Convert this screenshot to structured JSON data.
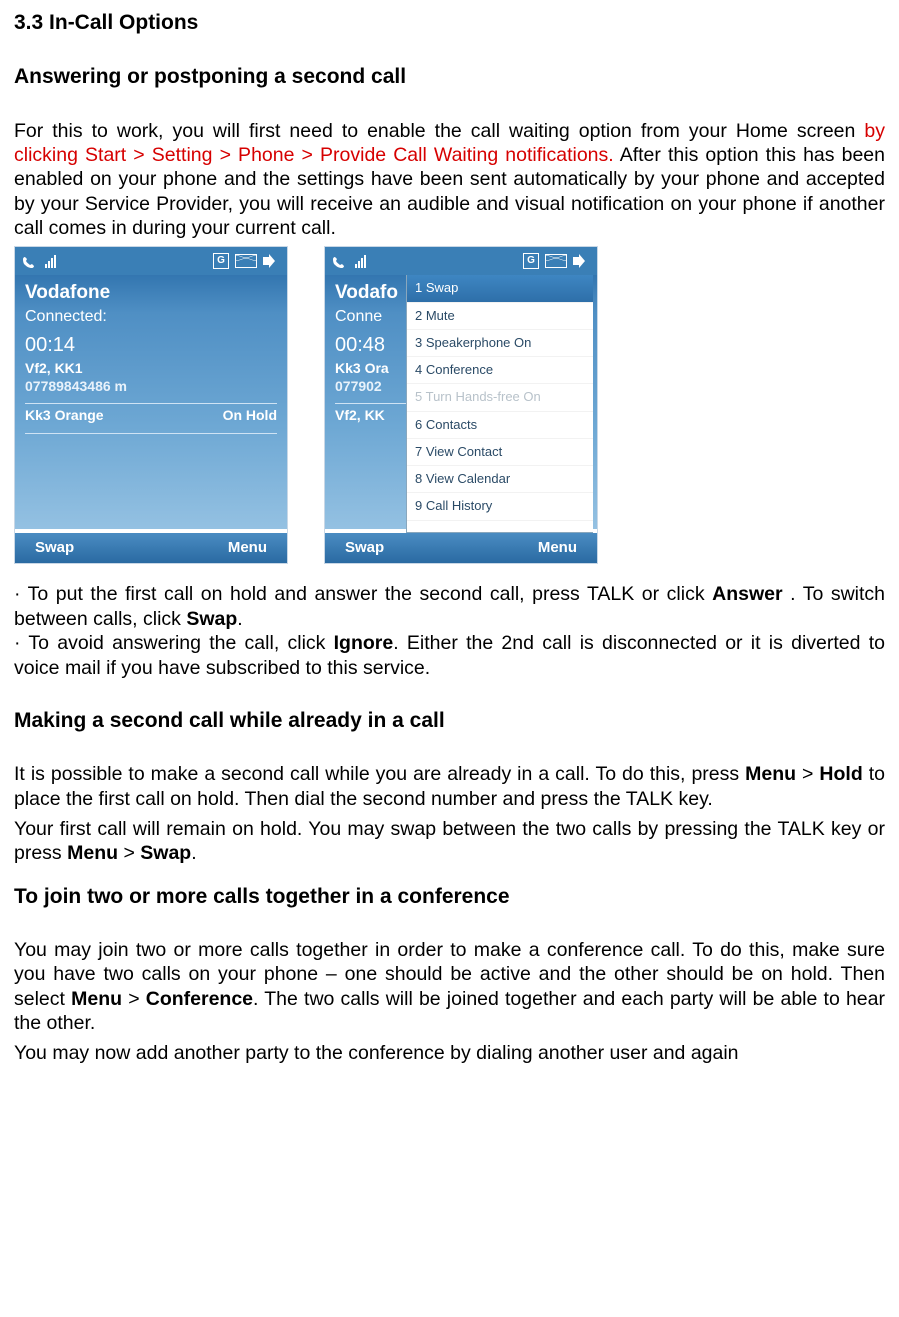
{
  "headings": {
    "h1": "3.3 In-Call Options",
    "h2": "Answering or postponing a second call",
    "h3": "Making a second call while already in a call",
    "h4": "To join two or more calls together in a conference"
  },
  "para1": {
    "l1": "For this to work, you will first need to enable the call waiting option from your Home screen ",
    "red": "by clicking Start > Setting > Phone > Provide Call Waiting notifications.",
    "l2": " After this option this has been enabled on your phone and the settings have been sent automatically by your phone and accepted by your Service Provider, you will receive an audible and visual notification on your phone if another call comes in during your current call."
  },
  "bullets": {
    "b1a": "· To put the first call on hold and answer the second call, press TALK or click ",
    "answer": "Answer",
    "b1b": " . To switch between calls, click ",
    "swap": "Swap",
    "b1end": ".",
    "b2a": "· To avoid answering the call, click ",
    "ignore": "Ignore",
    "b2b": ". Either the 2nd call is disconnected or it is diverted to voice mail if you have subscribed to this service."
  },
  "para2": {
    "l1": "It is possible to make a second call while you are already in a call. To do this, press ",
    "menu": "Menu",
    "gt": " > ",
    "hold": "Hold",
    "l2": " to place the first call on hold. Then dial the second number and press the TALK key.",
    "l3": "Your first call will remain on hold. You may swap between the two calls by pressing the TALK key or press ",
    "swap2": "Swap",
    "l3end": "."
  },
  "para3": {
    "l1": "You may join two or more calls together in order to make a conference call. To do this, make sure you have two calls on your phone – one should be active and the other should be on hold. Then select ",
    "menu": "Menu",
    "gt": " > ",
    "conf": "Conference",
    "l2": ". The two calls will be joined together and each party will be able to hear the other.",
    "l3": "You may now add another party to the conference by dialing another user and again"
  },
  "phone1": {
    "carrier": "Vodafone",
    "status": "Connected:",
    "timer": "00:14",
    "caller": "Vf2, KK1",
    "number": "07789843486 m",
    "hold_name": "Kk3 Orange",
    "hold_status": "On Hold",
    "sk_left": "Swap",
    "sk_right": "Menu",
    "g": "G"
  },
  "phone2": {
    "carrier": "Vodafo",
    "status": "Conne",
    "timer": "00:48",
    "caller": "Kk3 Ora",
    "number": "077902",
    "hold_name": "Vf2, KK",
    "sk_left": "Swap",
    "sk_right": "Menu",
    "g": "G",
    "menu": [
      {
        "n": "1",
        "t": "Swap",
        "sel": true
      },
      {
        "n": "2",
        "t": "Mute"
      },
      {
        "n": "3",
        "t": "Speakerphone On"
      },
      {
        "n": "4",
        "t": "Conference"
      },
      {
        "n": "5",
        "t": "Turn Hands-free On",
        "dis": true
      },
      {
        "n": "6",
        "t": "Contacts"
      },
      {
        "n": "7",
        "t": "View Contact"
      },
      {
        "n": "8",
        "t": "View Calendar"
      },
      {
        "n": "9",
        "t": "Call History"
      }
    ]
  }
}
